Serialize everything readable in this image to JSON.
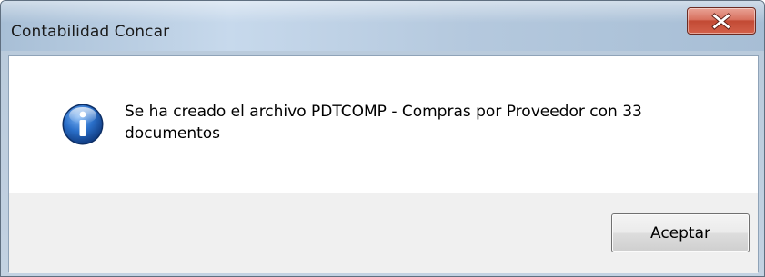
{
  "window": {
    "title": "Contabilidad Concar"
  },
  "message": {
    "text": "Se ha creado el archivo PDTCOMP - Compras por Proveedor con 33 documentos",
    "icon": "info-icon"
  },
  "buttons": {
    "ok_label": "Aceptar",
    "close_icon": "close-icon"
  },
  "colors": {
    "close_button": "#c24a34",
    "info_icon": "#2a6fc9"
  }
}
